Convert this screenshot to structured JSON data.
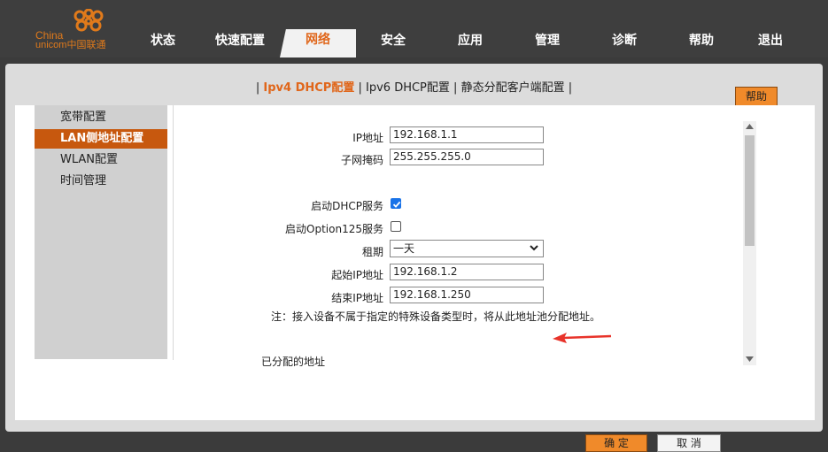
{
  "brand": {
    "logo_line1": "China",
    "logo_line2": "unicom中国联通"
  },
  "nav": {
    "tabs": [
      "状态",
      "快速配置",
      "网络",
      "安全",
      "应用",
      "管理",
      "诊断",
      "帮助",
      "退出"
    ],
    "active": "网络"
  },
  "subnav": {
    "items": [
      "Ipv4 DHCP配置",
      "Ipv6 DHCP配置",
      "静态分配客户端配置"
    ],
    "active": "Ipv4 DHCP配置",
    "separator": "|"
  },
  "help_button": "帮助",
  "sidebar": {
    "items": [
      "宽带配置",
      "LAN侧地址配置",
      "WLAN配置",
      "时间管理"
    ],
    "active": "LAN侧地址配置"
  },
  "form": {
    "ip_label": "IP地址",
    "ip_value": "192.168.1.1",
    "mask_label": "子网掩码",
    "mask_value": "255.255.255.0",
    "dhcp_label": "启动DHCP服务",
    "dhcp_checked": true,
    "opt125_label": "启动Option125服务",
    "opt125_checked": false,
    "lease_label": "租期",
    "lease_value": "一天",
    "start_label": "起始IP地址",
    "start_value": "192.168.1.2",
    "end_label": "结束IP地址",
    "end_value": "192.168.1.250",
    "note": "注：接入设备不属于指定的特殊设备类型时，将从此地址池分配地址。",
    "assigned_label": "已分配的地址"
  },
  "buttons": {
    "ok": "确 定",
    "cancel": "取 消"
  },
  "colors": {
    "accent": "#e0661a",
    "button_orange": "#f08a2a",
    "topbar": "#3e3e3e",
    "annotation_arrow": "#e8332a"
  },
  "icons": [
    "unicom-logo-icon",
    "chevron-down-icon",
    "checkmark-icon",
    "scroll-up-icon",
    "scroll-down-icon",
    "red-arrow-icon"
  ]
}
